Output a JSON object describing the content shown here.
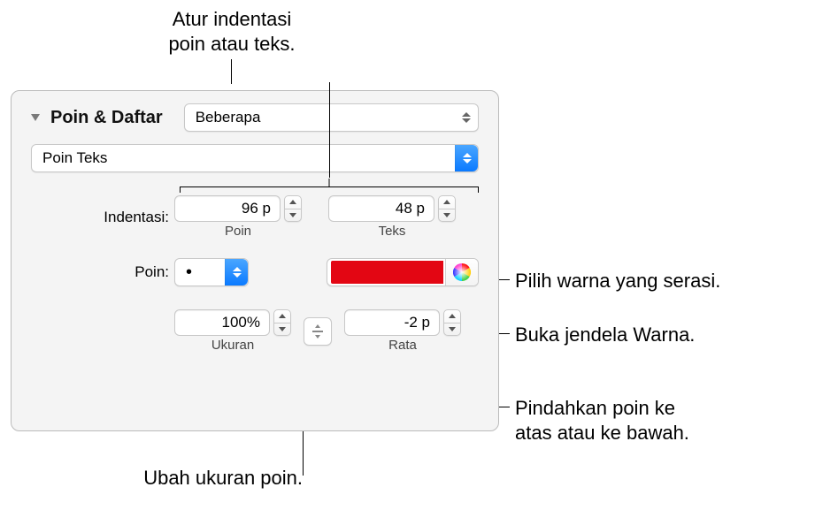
{
  "callouts": {
    "top": "Atur indentasi poin atau teks.",
    "right1": "Pilih warna yang serasi.",
    "right2": "Buka jendela Warna.",
    "right3_a": "Pindahkan poin ke",
    "right3_b": "atas atau ke bawah.",
    "bottom": "Ubah ukuran poin."
  },
  "section": {
    "title": "Poin & Daftar",
    "style_popup": "Beberapa",
    "bullet_type": "Poin Teks"
  },
  "indent": {
    "label": "Indentasi:",
    "bullet_value": "96 p",
    "bullet_sublabel": "Poin",
    "text_value": "48 p",
    "text_sublabel": "Teks"
  },
  "bullet": {
    "label": "Poin:",
    "character": "•",
    "color": "#e30613"
  },
  "size_align": {
    "size_value": "100%",
    "size_sublabel": "Ukuran",
    "align_value": "-2 p",
    "align_sublabel": "Rata"
  }
}
